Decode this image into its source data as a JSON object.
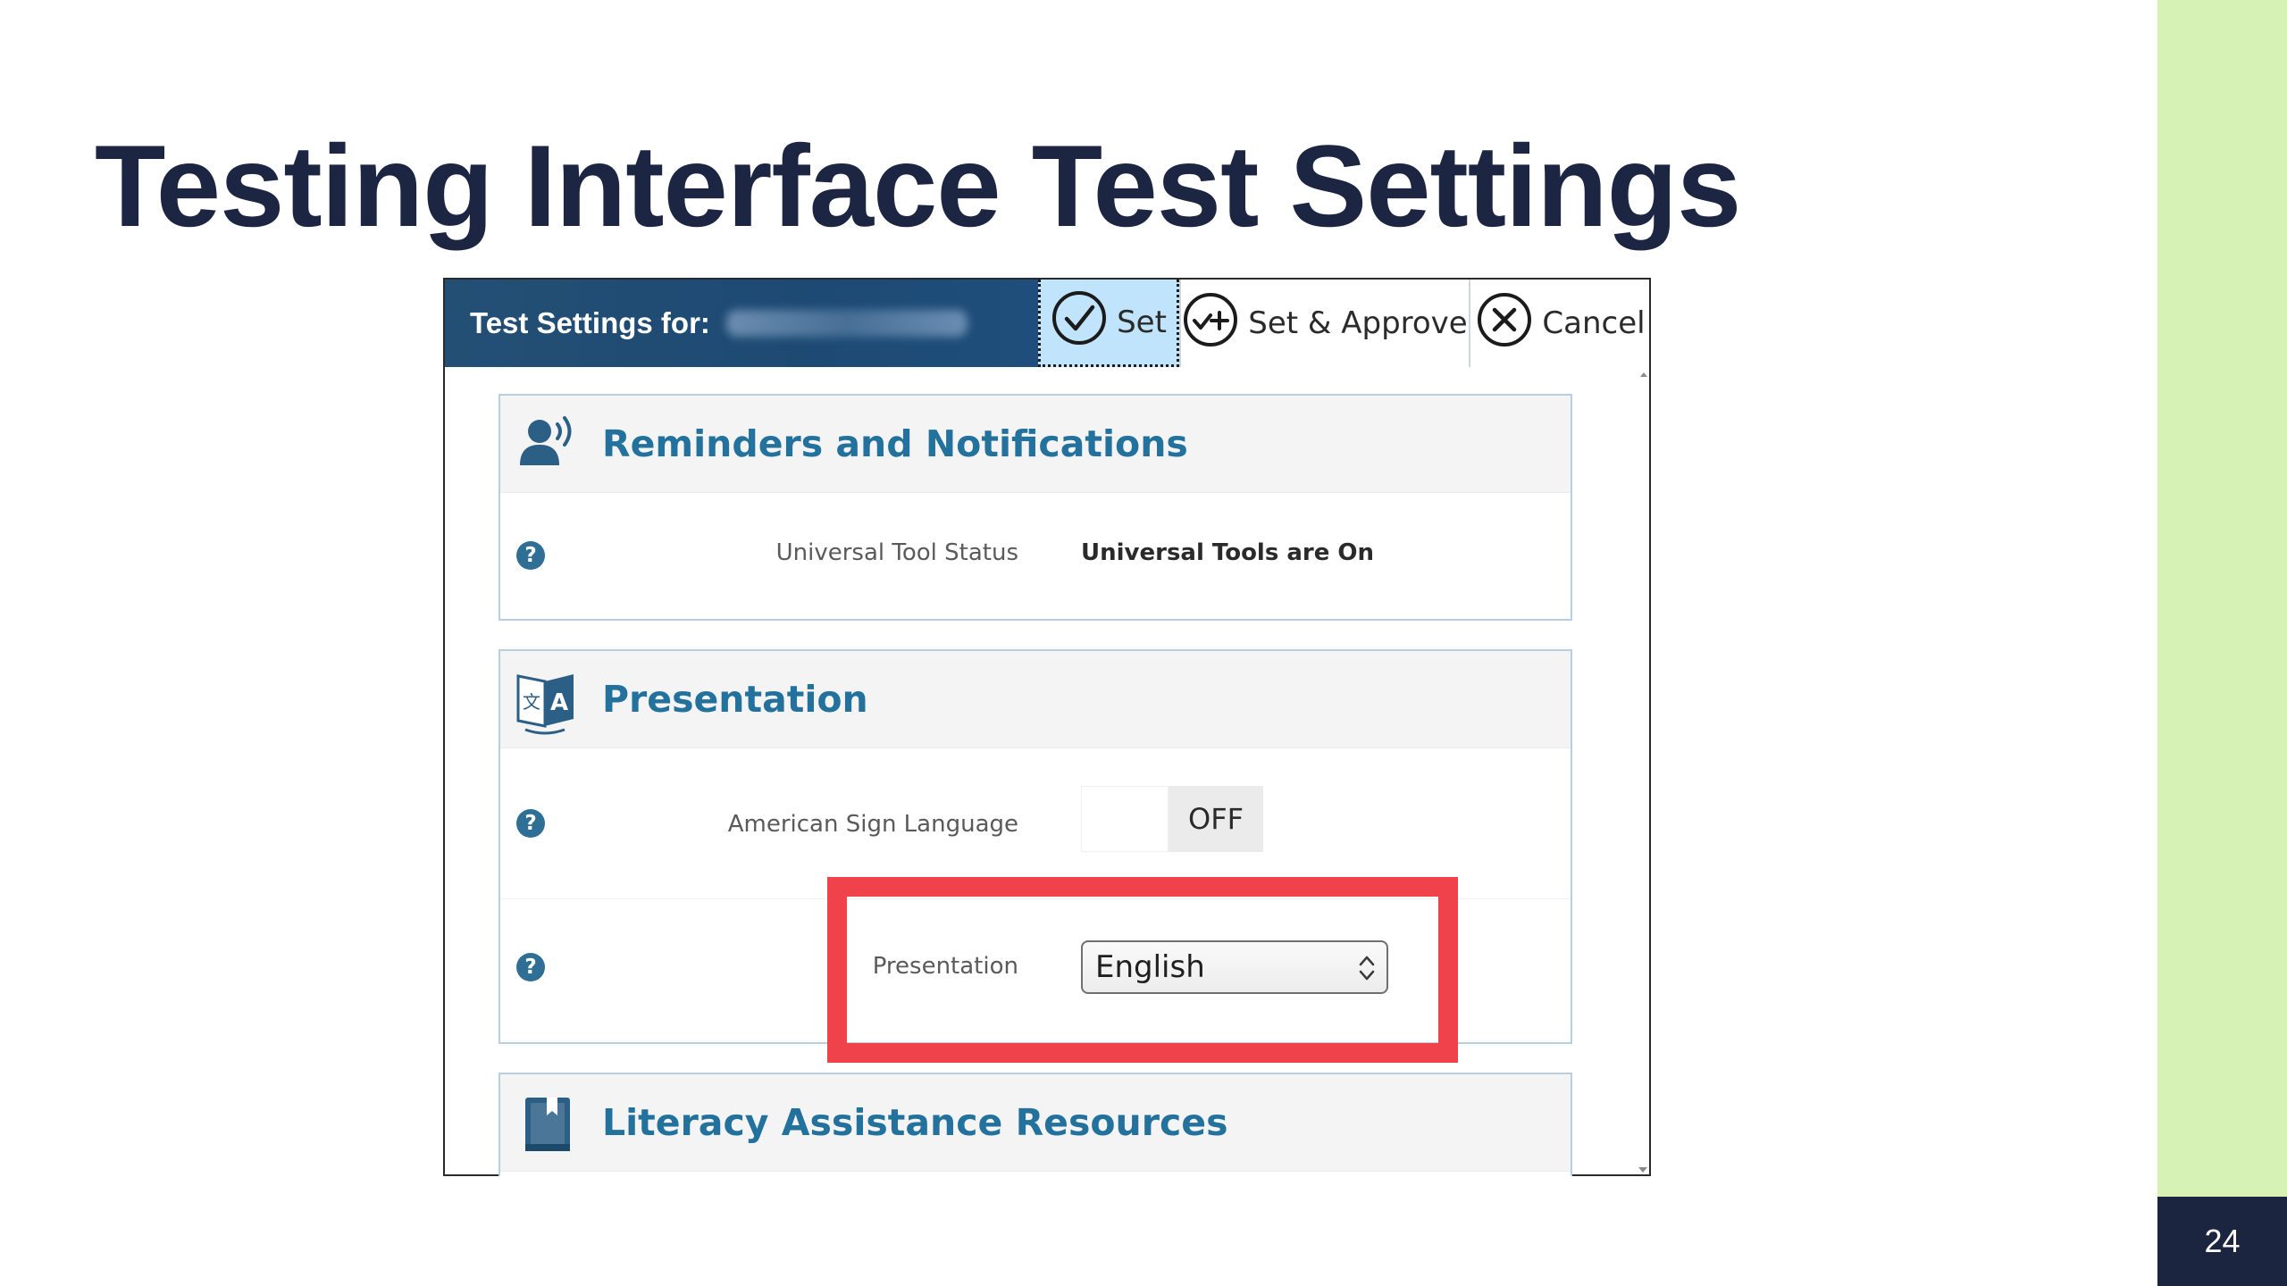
{
  "slide": {
    "title": "Testing Interface Test Settings",
    "page_number": "24"
  },
  "window": {
    "title": "Test Settings for:",
    "toolbar": {
      "set_label": "Set",
      "set_approve_label": "Set & Approve",
      "cancel_label": "Cancel"
    }
  },
  "sections": {
    "reminders": {
      "title": "Reminders and Notifications",
      "icon": "person-speaking-icon",
      "rows": [
        {
          "label": "Universal Tool Status",
          "value": "Universal Tools are On"
        }
      ]
    },
    "presentation": {
      "title": "Presentation",
      "icon": "translate-icon",
      "asl": {
        "label": "American Sign Language",
        "state": "OFF"
      },
      "presentation_select": {
        "label": "Presentation",
        "value": "English"
      }
    },
    "literacy": {
      "title": "Literacy Assistance Resources",
      "icon": "book-icon"
    }
  },
  "colors": {
    "title_text": "#1c2541",
    "header_bg": "#1f4e7c",
    "section_title": "#23719d",
    "set_button_bg": "#bfe4fb",
    "highlight": "#f0424a",
    "accent_green": "#d6f2b4",
    "page_number_bg": "#1b2540"
  }
}
